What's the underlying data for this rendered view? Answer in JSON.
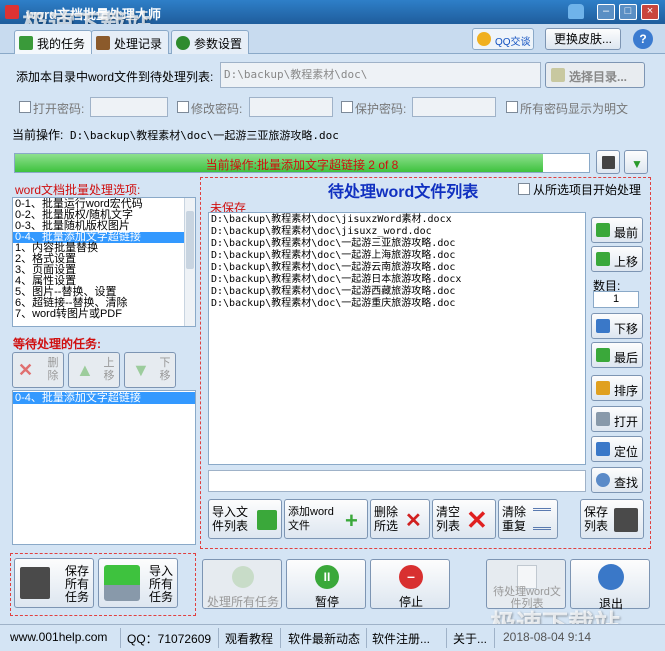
{
  "window": {
    "title": "word文档批量处理大师"
  },
  "watermark": {
    "text": "极速下载站"
  },
  "window_controls": {
    "minimize": "–",
    "maximize": "□",
    "close": "×"
  },
  "tabs": [
    {
      "label": "我的任务"
    },
    {
      "label": "处理记录"
    },
    {
      "label": "参数设置"
    }
  ],
  "header": {
    "qq_label": "QQ交谈",
    "skin_button": "更换皮肤...",
    "help_button": "?"
  },
  "add": {
    "label": "添加本目录中word文件到待处理列表:",
    "path_value": "D:\\backup\\教程素材\\doc\\",
    "select_dir_button": "选择目录..."
  },
  "passwords": {
    "open_label": "打开密码:",
    "modify_label": "修改密码:",
    "protect_label": "保护密码:",
    "show_plain_label": "所有密码显示为明文"
  },
  "current": {
    "label": "当前操作:",
    "value": "D:\\backup\\教程素材\\doc\\一起游三亚旅游攻略.doc"
  },
  "progress": {
    "text": "当前操作:批量添加文字超链接 2 of 8",
    "fraction": 0.92
  },
  "options": {
    "title": "word文档批量处理选项:",
    "items": [
      "0-1、批量运行word宏代码",
      "0-2、批量版权/随机文字",
      "0-3、批量随机版权图片",
      "0-4、批量添加文字超链接",
      "1、内容批量替换",
      "2、格式设置",
      "3、页面设置",
      "4、属性设置",
      "5、图片--替换、设置",
      "6、超链接--替换、清除",
      "7、word转图片或PDF"
    ],
    "selected_index": 3
  },
  "pending_tasks": {
    "title": "等待处理的任务:",
    "delete": "删除",
    "up": "上移",
    "down": "下移",
    "items": [
      "0-4、批量添加文字超链接"
    ]
  },
  "file_list": {
    "title": "待处理word文件列表",
    "start_from_selected": "从所选项目开始处理",
    "unsaved": "未保存",
    "files": [
      "D:\\backup\\教程素材\\doc\\jisuxzWord素材.docx",
      "D:\\backup\\教程素材\\doc\\jisuxz_word.doc",
      "D:\\backup\\教程素材\\doc\\一起游三亚旅游攻略.doc",
      "D:\\backup\\教程素材\\doc\\一起游上海旅游攻略.doc",
      "D:\\backup\\教程素材\\doc\\一起游云南旅游攻略.doc",
      "D:\\backup\\教程素材\\doc\\一起游日本旅游攻略.docx",
      "D:\\backup\\教程素材\\doc\\一起游西藏旅游攻略.doc",
      "D:\\backup\\教程素材\\doc\\一起游重庆旅游攻略.doc"
    ]
  },
  "side_buttons": {
    "top": "最前",
    "up": "上移",
    "count_label": "数目:",
    "count_value": "1",
    "down": "下移",
    "bottom": "最后",
    "sort": "排序",
    "open": "打开",
    "locate": "定位",
    "find": "查找"
  },
  "list_buttons": {
    "import": "导入文件列表",
    "add": "添加word文件",
    "delete": "删除所选",
    "clear": "清空列表",
    "dedupe": "清除重复",
    "save": "保存列表"
  },
  "bottom_buttons": {
    "save_all": "保存所有任务",
    "import_all": "导入所有任务",
    "process_all": "处理所有任务",
    "pause": "暂停",
    "stop": "停止",
    "process_pending": "待处理word文件列表",
    "exit": "退出"
  },
  "status": {
    "site": "www.001help.com",
    "qq": "QQ：71072609",
    "tutorial": "观看教程",
    "news": "软件最新动态",
    "register": "软件注册...",
    "about": "关于...",
    "datetime": "2018-08-04  9:14"
  },
  "colors": {
    "accent": "#1f5d9c",
    "progress": "#3ec23e",
    "title_blue": "#1030c0",
    "red": "#d01010",
    "selection": "#3399ff"
  }
}
